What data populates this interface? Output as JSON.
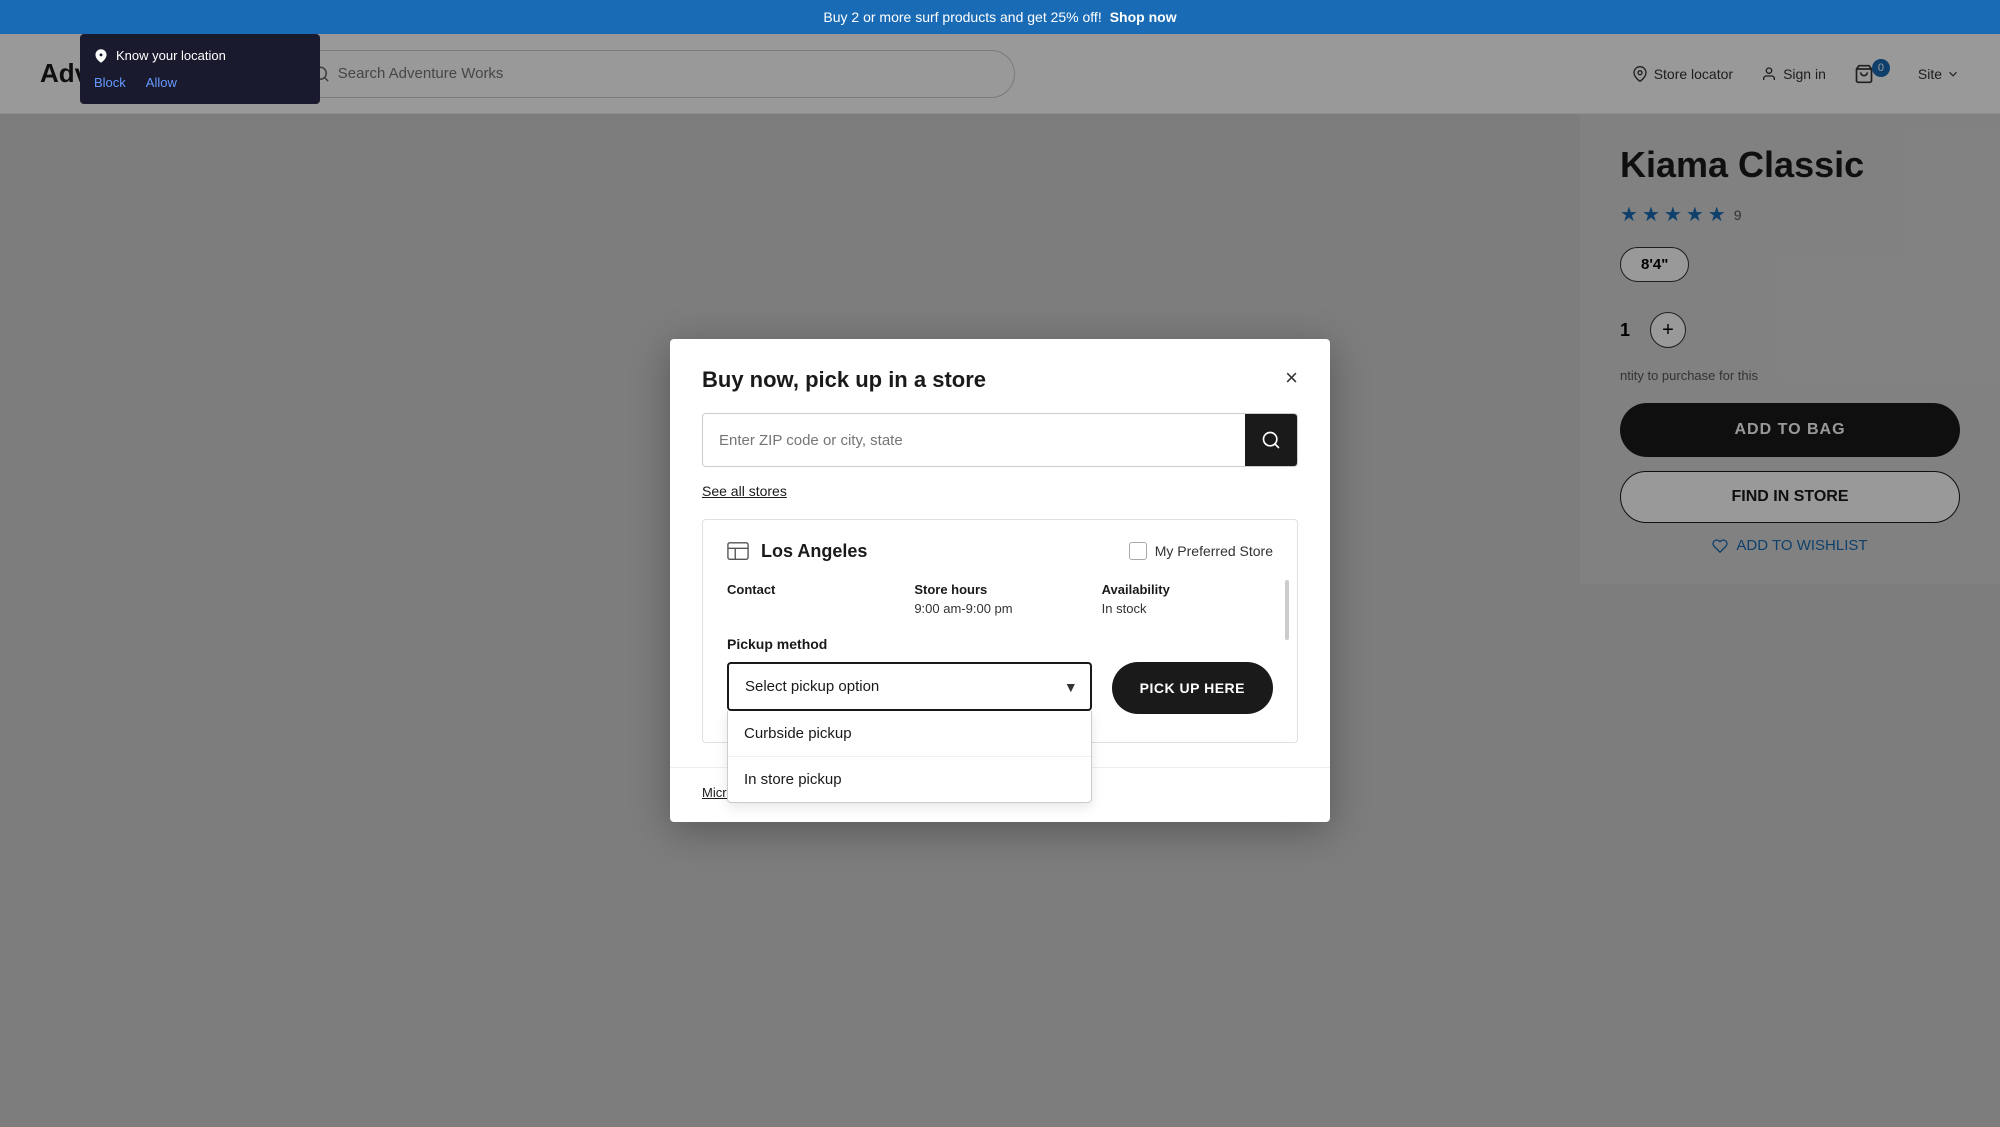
{
  "promo": {
    "text": "Buy 2 or more surf products and get 25% off!",
    "link_text": "Shop now"
  },
  "header": {
    "logo": "dventure Works",
    "search_placeholder": "Search Adventure Works",
    "store_locator": "Store locator",
    "sign_in": "Sign in",
    "cart_count": "0",
    "site": "Site"
  },
  "product": {
    "title": "Kiama Classic",
    "review_count": "9",
    "size": "8'4\"",
    "quantity": "1",
    "quantity_note": "ntity to purchase for this",
    "add_to_bag": "ADD TO BAG",
    "find_in_store": "FIND IN STORE",
    "add_to_wishlist": "ADD TO WISHLIST"
  },
  "location_popup": {
    "title": "Know your location",
    "block_label": "Block",
    "allow_label": "Allow"
  },
  "modal": {
    "title": "Buy now, pick up in a store",
    "close_label": "×",
    "zip_placeholder": "Enter ZIP code or city, state",
    "see_all_stores": "See all stores",
    "store": {
      "name": "Los Angeles",
      "preferred_store_label": "My Preferred Store",
      "contact_label": "Contact",
      "store_hours_label": "Store hours",
      "store_hours_value": "9:00 am-9:00 pm",
      "availability_label": "Availability",
      "availability_value": "In stock",
      "pickup_method_label": "Pickup method",
      "pickup_select_label": "Select pickup option",
      "option_1": "Curbside pickup",
      "option_2": "In store pickup",
      "pick_up_here": "PICK UP HERE"
    },
    "footer_link": "Microsoft Bing Maps Terms"
  }
}
